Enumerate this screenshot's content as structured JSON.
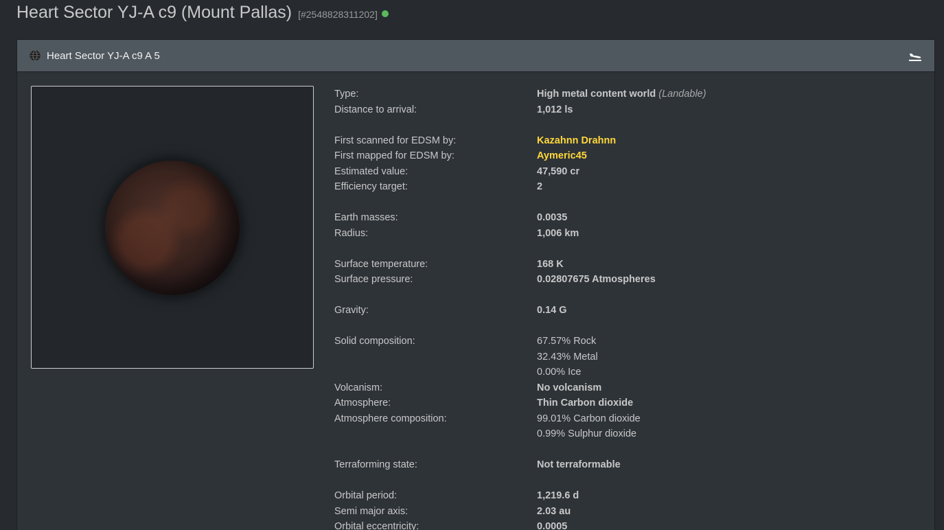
{
  "header": {
    "title": "Heart Sector YJ-A c9 (Mount Pallas)",
    "system_id": "[#2548828311202]",
    "status_color": "#5cb85c"
  },
  "panel": {
    "body_name": "Heart Sector YJ-A c9 A 5",
    "globe_icon": "globe-icon",
    "landing_icon": "landing-icon"
  },
  "details": {
    "type": {
      "label": "Type:",
      "value": "High metal content world",
      "note": "(Landable)"
    },
    "distance": {
      "label": "Distance to arrival:",
      "value": "1,012 ls"
    },
    "first_scanned": {
      "label": "First scanned for EDSM by:",
      "value": "Kazahnn Drahnn"
    },
    "first_mapped": {
      "label": "First mapped for EDSM by:",
      "value": "Aymeric45"
    },
    "estimated_value": {
      "label": "Estimated value:",
      "value": "47,590 cr"
    },
    "efficiency": {
      "label": "Efficiency target:",
      "value": "2"
    },
    "earth_masses": {
      "label": "Earth masses:",
      "value": "0.0035"
    },
    "radius": {
      "label": "Radius:",
      "value": "1,006 km"
    },
    "surface_temp": {
      "label": "Surface temperature:",
      "value": "168 K"
    },
    "surface_pressure": {
      "label": "Surface pressure:",
      "value": "0.02807675 Atmospheres"
    },
    "gravity": {
      "label": "Gravity:",
      "value": "0.14 G"
    },
    "solid_composition": {
      "label": "Solid composition:",
      "values": [
        "67.57% Rock",
        "32.43% Metal",
        "0.00% Ice"
      ]
    },
    "volcanism": {
      "label": "Volcanism:",
      "value": "No volcanism"
    },
    "atmosphere": {
      "label": "Atmosphere:",
      "value": "Thin Carbon dioxide"
    },
    "atmosphere_composition": {
      "label": "Atmosphere composition:",
      "values": [
        "99.01% Carbon dioxide",
        "0.99% Sulphur dioxide"
      ]
    },
    "terraforming": {
      "label": "Terraforming state:",
      "value": "Not terraformable"
    },
    "orbital_period": {
      "label": "Orbital period:",
      "value": "1,219.6 d"
    },
    "semi_major_axis": {
      "label": "Semi major axis:",
      "value": "2.03 au"
    },
    "orbital_eccentricity": {
      "label": "Orbital eccentricity:",
      "value": "0.0005"
    }
  },
  "colors": {
    "highlight": "#ffd83a",
    "background": "#272b30",
    "panel_heading": "#50585f"
  }
}
